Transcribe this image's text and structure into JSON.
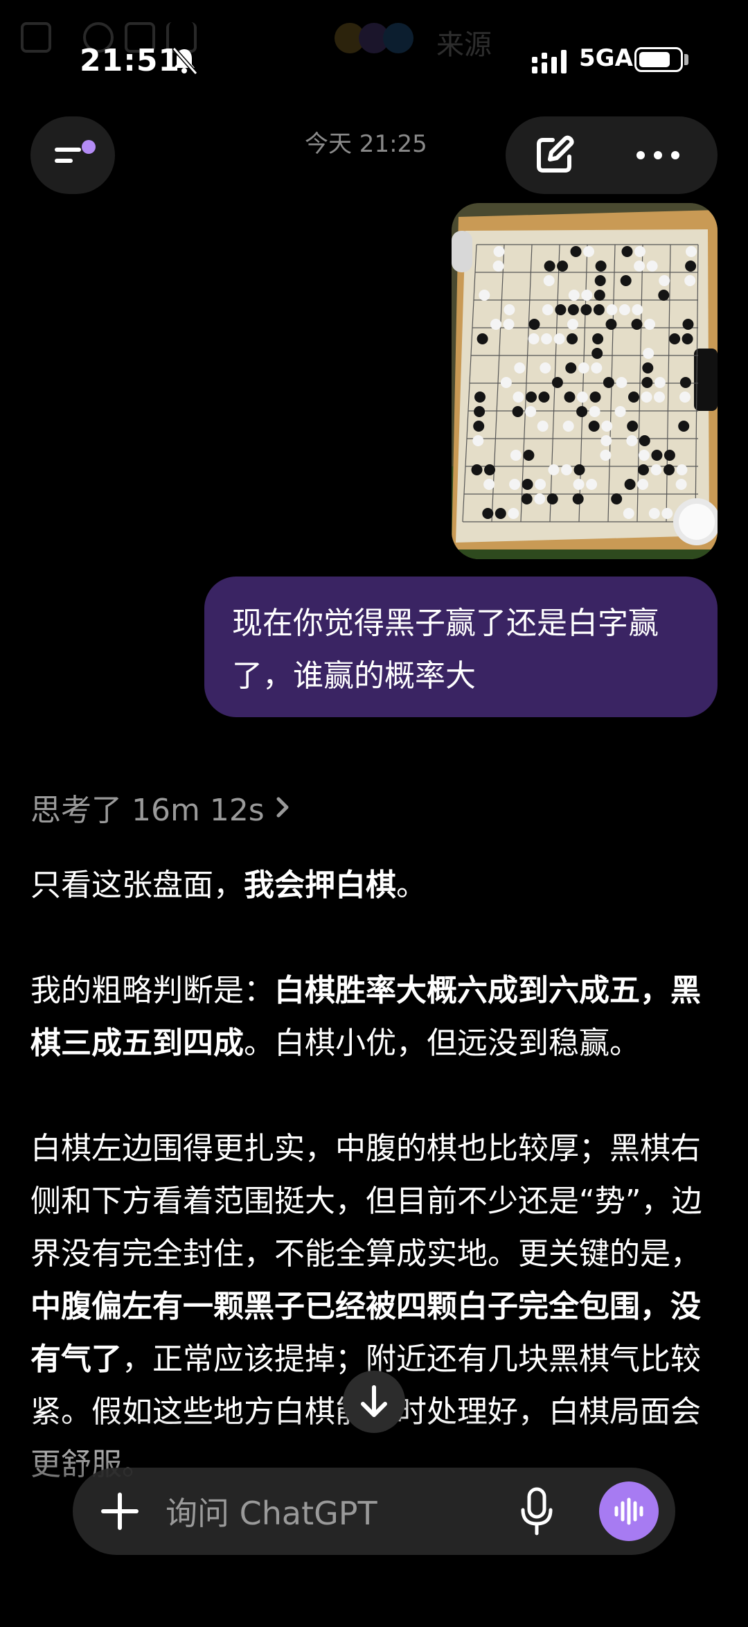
{
  "background_bar": {
    "source_label": "来源"
  },
  "status_bar": {
    "time": "21:51",
    "network": "5GA",
    "icons": [
      "bell-muted-icon",
      "signal-icon",
      "battery-icon"
    ]
  },
  "header": {
    "date_label": "今天 21:25",
    "icons": [
      "menu-icon",
      "edit-icon",
      "more-icon"
    ]
  },
  "conversation": {
    "user_message": "现在你觉得黑子赢了还是白字赢了，谁赢的概率大",
    "thought_label": "思考了 16m 12s",
    "answer": {
      "p1_normal": "只看这张盘面，",
      "p1_bold": "我会押白棋",
      "p1_end": "。",
      "p2_normal1": "我的粗略判断是：",
      "p2_bold": "白棋胜率大概六成到六成五，黑棋三成五到四成",
      "p2_normal2": "。白棋小优，但远没到稳赢。",
      "p3_normal1": "白棋左边围得更扎实，中腹的棋也比较厚；黑棋右侧和下方看着范围挺大，但目前不少还是“势”，边界没有完全封住，不能全算成实地。更关键的是，",
      "p3_bold": "中腹偏左有一颗黑子已经被四颗白子完全包围，没有气了",
      "p3_normal2": "，正常应该提掉；附近还有几块黑棋气比较紧。假如这些地方白棋能及时处理好，白棋局面会更舒服。"
    }
  },
  "composer": {
    "placeholder": "询问 ChatGPT",
    "accent_color": "#a77bf2"
  },
  "colors": {
    "user_bubble": "#3a2463",
    "panel": "#1e1e1e",
    "notification_dot": "#b48cf5"
  }
}
